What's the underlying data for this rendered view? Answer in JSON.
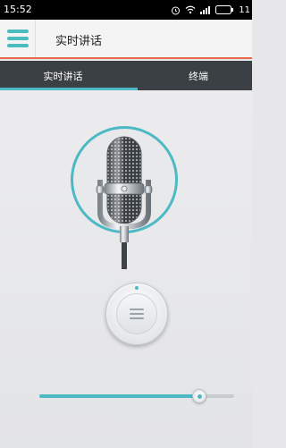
{
  "status_bar": {
    "time": "15:52",
    "battery_text": "11",
    "icons": [
      "alarm-icon",
      "wifi-icon",
      "signal-icon",
      "battery-icon"
    ]
  },
  "app_bar": {
    "title": "实时讲话",
    "accent_color": "#ec6a49",
    "menu_icon": "menu-icon"
  },
  "tabs": [
    {
      "label": "实时讲话",
      "selected": true
    },
    {
      "label": "终端",
      "selected": false
    }
  ],
  "colors": {
    "accent": "#4cb9c5",
    "tab_bar": "#3a4043",
    "background": "#e7e7e9"
  },
  "main": {
    "microphone_icon": "microphone-icon",
    "control_button_icon": "list-icon"
  },
  "volume_slider": {
    "value": 0.82
  }
}
